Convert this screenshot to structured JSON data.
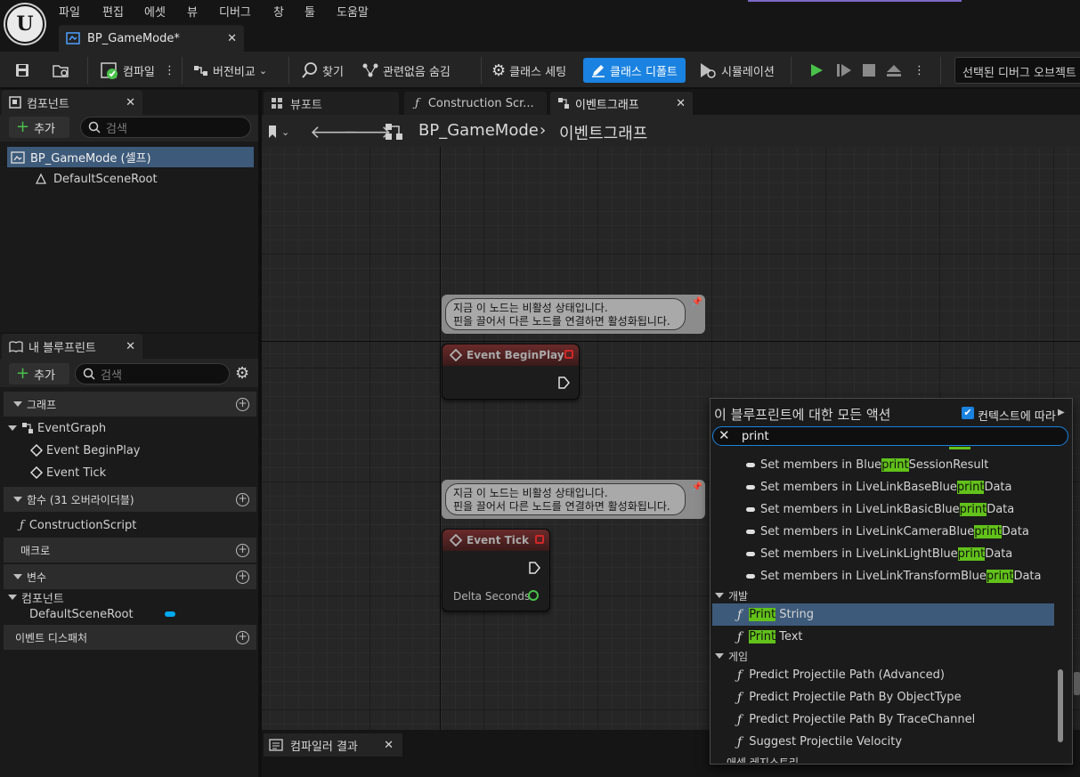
{
  "menu": [
    "파일",
    "편집",
    "에셋",
    "뷰",
    "디버그",
    "창",
    "툴",
    "도움말"
  ],
  "doc_tab": {
    "title": "BP_GameMode*"
  },
  "toolbar": {
    "compile": "컴파일",
    "diff": "버전비교",
    "find": "찾기",
    "hide_unrelated": "관련없음 숨김",
    "class_settings": "클래스 세팅",
    "class_defaults": "클래스 디폴트",
    "simulation": "시뮬레이션",
    "debug_object": "선택된 디버그 오브젝트 없음"
  },
  "components_panel": {
    "title": "컴포넌트",
    "add": "추가",
    "search_placeholder": "검색",
    "items": [
      "BP_GameMode (셀프)",
      "DefaultSceneRoot"
    ]
  },
  "my_blueprint": {
    "title": "내 블루프린트",
    "add": "추가",
    "search_placeholder": "검색",
    "graph_cat": "그래프",
    "event_graph": "EventGraph",
    "events": [
      "Event BeginPlay",
      "Event Tick"
    ],
    "functions_cat": "함수 (31 오버라이더블)",
    "construction_script": "ConstructionScript",
    "macros_cat": "매크로",
    "variables_cat": "변수",
    "components_sub": "컴포넌트",
    "default_scene_root": "DefaultSceneRoot",
    "dispatchers_cat": "이벤트 디스패처"
  },
  "graph_tabs": [
    "뷰포트",
    "Construction Scr...",
    "이벤트그래프"
  ],
  "breadcrumb": {
    "root": "BP_GameMode",
    "current": "이벤트그래프"
  },
  "nodes": {
    "comment_line1": "지금 이 노드는 비활성 상태입니다.",
    "comment_line2": "핀을 끌어서 다른 노드를 연결하면 활성화됩니다.",
    "begin_play": "Event BeginPlay",
    "tick": "Event Tick",
    "delta_seconds": "Delta Seconds"
  },
  "compiler_results": "컴파일러 결과",
  "action_menu": {
    "title": "이 블루프린트에 대한 모든 액션",
    "context": "컨텍스트에 따라",
    "query": "print",
    "set_members": [
      {
        "pre": "Set members in Blue",
        "hl": "print",
        "post": "SessionResult"
      },
      {
        "pre": "Set members in LiveLinkBaseBlue",
        "hl": "print",
        "post": "Data"
      },
      {
        "pre": "Set members in LiveLinkBasicBlue",
        "hl": "print",
        "post": "Data"
      },
      {
        "pre": "Set members in LiveLinkCameraBlue",
        "hl": "print",
        "post": "Data"
      },
      {
        "pre": "Set members in LiveLinkLightBlue",
        "hl": "print",
        "post": "Data"
      },
      {
        "pre": "Set members in LiveLinkTransformBlue",
        "hl": "print",
        "post": "Data"
      }
    ],
    "cat_dev": "개발",
    "print_string": {
      "hl": "Print",
      "post": " String"
    },
    "print_text": {
      "hl": "Print",
      "post": " Text"
    },
    "cat_game": "게임",
    "game_items": [
      "Predict Projectile Path (Advanced)",
      "Predict Projectile Path By ObjectType",
      "Predict Projectile Path By TraceChannel",
      "Suggest Projectile Velocity"
    ],
    "cat_partial": "애셋 레지스트리"
  },
  "colors": {
    "accent": "#1a82e0",
    "highlight": "#62c21a",
    "event_red": "#d02828"
  }
}
